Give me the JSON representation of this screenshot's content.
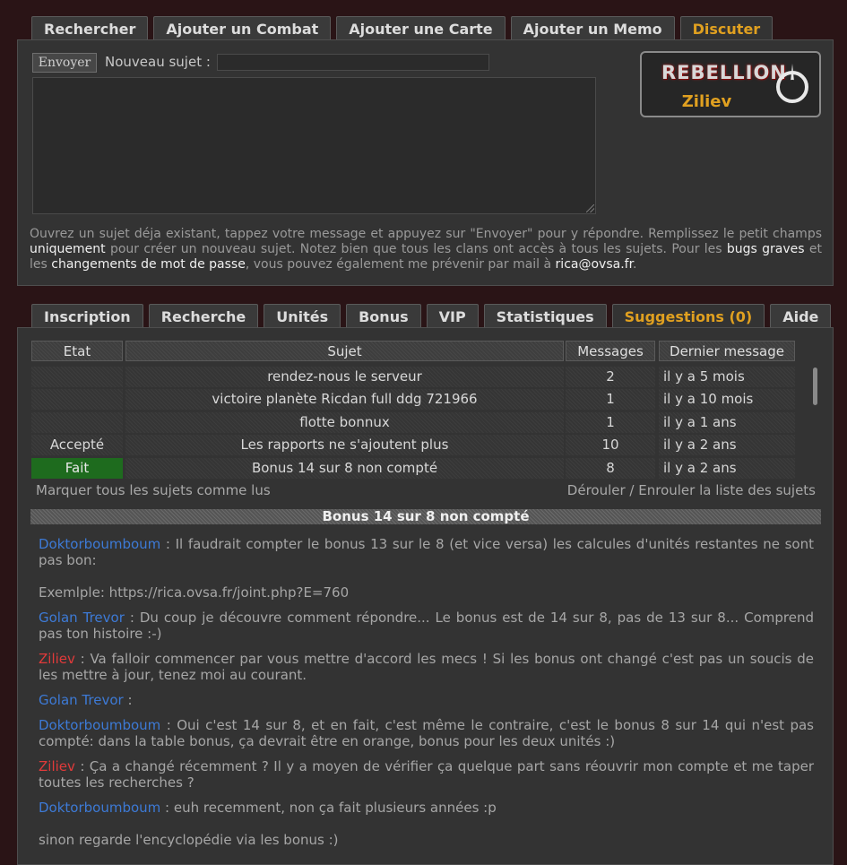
{
  "top_tabs": [
    "Rechercher",
    "Ajouter un Combat",
    "Ajouter une Carte",
    "Ajouter un Memo",
    "Discuter"
  ],
  "top_active_tab": "Discuter",
  "compose": {
    "send_label": "Envoyer",
    "new_subject_label": "Nouveau sujet :",
    "new_subject_value": "",
    "message_value": ""
  },
  "badge": {
    "logo": "REBELLION",
    "name": "Ziliev"
  },
  "info": {
    "p1": "Ouvrez un sujet déja existant, tappez votre message et appuyez sur \"Envoyer\" pour y répondre. Remplissez le petit champs ",
    "h1": "uniquement",
    "p2": " pour créer un nouveau sujet. Notez bien que tous les clans ont accès à tous les sujets. Pour les ",
    "h2": "bugs graves",
    "p3": " et les ",
    "h3": "changements de mot de passe",
    "p4": ", vous pouvez également me prévenir par mail à ",
    "h4": "rica@ovsa.fr",
    "p5": "."
  },
  "bottom_tabs": [
    "Inscription",
    "Recherche",
    "Unités",
    "Bonus",
    "VIP",
    "Statistiques",
    "Suggestions (0)",
    "Aide"
  ],
  "bottom_active_tab": "Suggestions (0)",
  "table": {
    "headers": [
      "Etat",
      "Sujet",
      "Messages",
      "Dernier message"
    ],
    "rows": [
      {
        "etat": "",
        "sujet": "rendez-nous le serveur",
        "messages": "2",
        "dernier": "il y a 5 mois"
      },
      {
        "etat": "",
        "sujet": "victoire planète Ricdan full ddg 721966",
        "messages": "1",
        "dernier": "il y a 10 mois"
      },
      {
        "etat": "",
        "sujet": "flotte bonnux",
        "messages": "1",
        "dernier": "il y a 1 ans"
      },
      {
        "etat": "Accepté",
        "sujet": "Les rapports ne s'ajoutent plus",
        "messages": "10",
        "dernier": "il y a 2 ans"
      },
      {
        "etat": "Fait",
        "sujet": "Bonus 14 sur 8 non compté",
        "messages": "8",
        "dernier": "il y a 2 ans"
      }
    ]
  },
  "mark_all_read": "Marquer tous les sujets comme lus",
  "toggle_list": "Dérouler / Enrouler la liste des sujets",
  "current_subject": "Bonus 14 sur 8 non compté",
  "posts": [
    {
      "author": "Doktorboumboum",
      "color": "#3d7ad6",
      "lines": [
        " : Il faudrait compter le bonus 13 sur le 8 (et vice versa) les calcules d'unités restantes ne sont pas bon:",
        "",
        "Exemlple: https://rica.ovsa.fr/joint.php?E=760"
      ]
    },
    {
      "author": "Golan Trevor",
      "color": "#3d7ad6",
      "lines": [
        " : Du coup je découvre comment répondre... Le bonus est de 14 sur 8, pas de 13 sur 8... Comprend pas ton histoire :-)"
      ]
    },
    {
      "author": "Ziliev",
      "color": "#e03a3a",
      "lines": [
        " : Va falloir commencer par vous mettre d'accord les mecs ! Si les bonus ont changé c'est pas un soucis de les mettre à jour, tenez moi au courant."
      ]
    },
    {
      "author": "Golan Trevor",
      "color": "#3d7ad6",
      "lines": [
        " :"
      ]
    },
    {
      "author": "Doktorboumboum",
      "color": "#3d7ad6",
      "lines": [
        " : Oui c'est 14 sur 8, et en fait, c'est même le contraire, c'est le bonus 8 sur 14 qui n'est pas compté: dans la table bonus, ça devrait être en orange, bonus pour les deux unités :)"
      ]
    },
    {
      "author": "Ziliev",
      "color": "#e03a3a",
      "lines": [
        " : Ça a changé récemment ? Il y a moyen de vérifier ça quelque part sans réouvrir mon compte et me taper toutes les recherches ?"
      ]
    },
    {
      "author": "Doktorboumboum",
      "color": "#3d7ad6",
      "lines": [
        " : euh recemment, non ça fait plusieurs années :p",
        "",
        "sinon regarde l'encyclopédie via les bonus :)"
      ]
    }
  ]
}
